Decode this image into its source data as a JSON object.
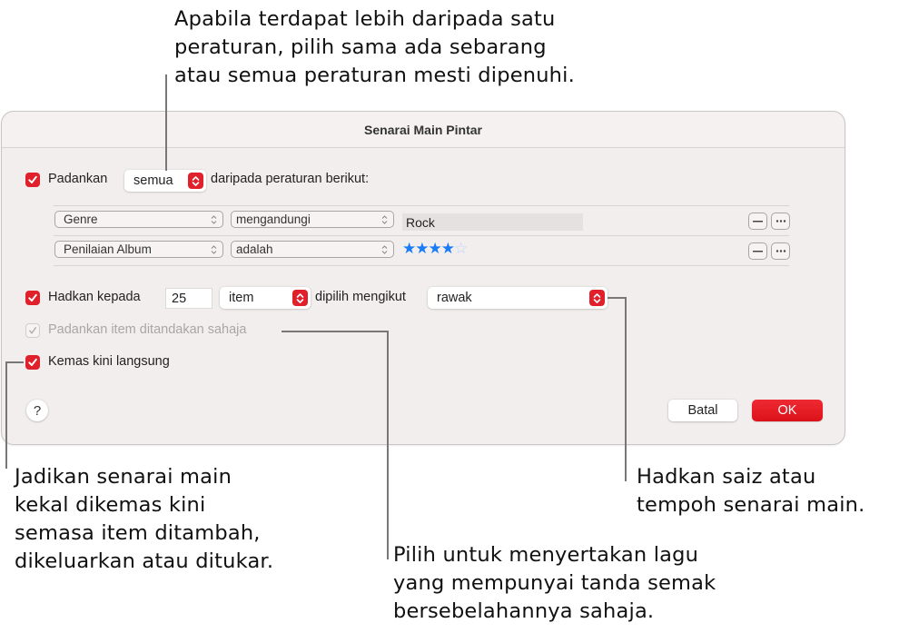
{
  "callouts": {
    "match_rules": [
      "Apabila terdapat lebih daripada satu",
      "peraturan, pilih sama ada sebarang",
      "atau semua peraturan mesti dipenuhi."
    ],
    "live_updating": [
      "Jadikan senarai main",
      "kekal dikemas kini",
      "semasa item ditambah,",
      "dikeluarkan atau ditukar."
    ],
    "checked_only": [
      "Pilih untuk menyertakan lagu",
      "yang mempunyai tanda semak",
      "bersebelahannya sahaja."
    ],
    "limit": [
      "Hadkan saiz atau",
      "tempoh senarai main."
    ]
  },
  "dialog": {
    "title": "Senarai Main Pintar",
    "match": {
      "checked": true,
      "label": "Padankan",
      "selector_value": "semua",
      "suffix": "daripada peraturan berikut:"
    },
    "rules": [
      {
        "field": "Genre",
        "operator": "mengandungi",
        "value": "Rock"
      },
      {
        "field": "Penilaian Album",
        "operator": "adalah",
        "rating": 4,
        "rating_max": 5
      }
    ],
    "limit": {
      "checked": true,
      "label": "Hadkan kepada",
      "amount": "25",
      "unit": "item",
      "selected_by_label": "dipilih mengikut",
      "selected_by": "rawak"
    },
    "checked_only": {
      "checked": true,
      "enabled": false,
      "label": "Padankan item ditandakan sahaja"
    },
    "live_updating": {
      "checked": true,
      "label": "Kemas kini langsung"
    },
    "help_label": "?",
    "cancel_label": "Batal",
    "ok_label": "OK"
  },
  "colors": {
    "accent": "#e0202a",
    "star": "#1a7cf5",
    "dialog_bg": "#f3eeee"
  }
}
